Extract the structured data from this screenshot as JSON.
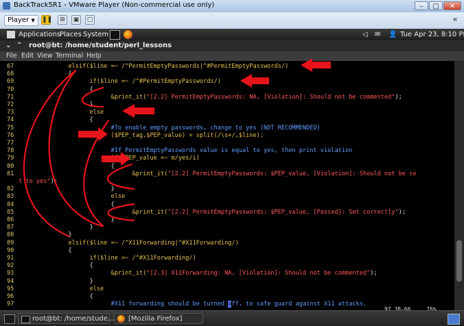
{
  "window": {
    "title": "BackTrack5R1 - VMware Player (Non-commercial use only)"
  },
  "vm_toolbar": {
    "player_label": "Player",
    "player_arrow": "▼"
  },
  "gnome_panel": {
    "applications": "Applications",
    "places": "Places",
    "system": "System",
    "datetime": "Tue Apr 23,  8:10 PM"
  },
  "terminal": {
    "title": "root@bt: /home/student/perl_lessons",
    "menu": [
      "File",
      "Edit",
      "View",
      "Terminal",
      "Help"
    ]
  },
  "code_lines": [
    {
      "n": "67",
      "segs": [
        [
          "              ",
          "w"
        ],
        [
          "elsif($line =~ /^PermitEmptyPasswords|^#PermitEmptyPasswords/)",
          "y"
        ]
      ]
    },
    {
      "n": "68",
      "segs": [
        [
          "              {",
          "w"
        ]
      ]
    },
    {
      "n": "69",
      "segs": [
        [
          "                    ",
          "w"
        ],
        [
          "if($line =~ /^#PermitEmptyPasswords/)",
          "y"
        ]
      ]
    },
    {
      "n": "70",
      "segs": [
        [
          "                    {",
          "w"
        ]
      ]
    },
    {
      "n": "71",
      "segs": [
        [
          "                          ",
          "w"
        ],
        [
          "&print_it(",
          "y"
        ],
        [
          "\"[2.2] PermitEmptyPasswords: NA, [Violation]: Should not be commented\"",
          "r"
        ],
        [
          ");",
          "w"
        ]
      ]
    },
    {
      "n": "72",
      "segs": [
        [
          "                    }",
          "w"
        ]
      ]
    },
    {
      "n": "73",
      "segs": [
        [
          "                    ",
          "w"
        ],
        [
          "else",
          "y"
        ]
      ]
    },
    {
      "n": "74",
      "segs": [
        [
          "                    {",
          "w"
        ]
      ]
    },
    {
      "n": "75",
      "segs": [
        [
          "                          ",
          "w"
        ],
        [
          "#To enable empty passwords, change to yes (NOT RECOMMENDED)",
          "c"
        ]
      ]
    },
    {
      "n": "76",
      "segs": [
        [
          "                          ",
          "w"
        ],
        [
          "($PEP_tag,$PEP_value) = split(/\\s+/,$line);",
          "y"
        ]
      ]
    },
    {
      "n": "77",
      "segs": []
    },
    {
      "n": "78",
      "segs": [
        [
          "                          ",
          "w"
        ],
        [
          "#If PermitEmptyPasswords value is equal to yes, then print violation",
          "c"
        ]
      ]
    },
    {
      "n": "79",
      "segs": [
        [
          "                          ",
          "w"
        ],
        [
          "if($PEP_value =~ m/yes/i)",
          "y"
        ]
      ]
    },
    {
      "n": "80",
      "segs": [
        [
          "                          {",
          "w"
        ]
      ]
    },
    {
      "n": "81",
      "segs": [
        [
          "                                ",
          "w"
        ],
        [
          "&print_it(",
          "y"
        ],
        [
          "\"[2.2] PermitEmptyPasswords: $PEP_value, [Violation]: Should not be se",
          "r"
        ]
      ]
    },
    {
      "n": "",
      "segs": [
        [
          "t to yes\"",
          "r"
        ],
        [
          ");",
          "w"
        ]
      ]
    },
    {
      "n": "82",
      "segs": [
        [
          "                          }",
          "w"
        ]
      ]
    },
    {
      "n": "83",
      "segs": [
        [
          "                          ",
          "w"
        ],
        [
          "else",
          "y"
        ]
      ]
    },
    {
      "n": "84",
      "segs": [
        [
          "                          {",
          "w"
        ]
      ]
    },
    {
      "n": "85",
      "segs": [
        [
          "                                ",
          "w"
        ],
        [
          "&print_it(",
          "y"
        ],
        [
          "\"[2.2] PermitEmptyPasswords: $PEP_value, [Passed]: Set correctly\"",
          "r"
        ],
        [
          ");",
          "w"
        ]
      ]
    },
    {
      "n": "86",
      "segs": [
        [
          "                          }",
          "w"
        ]
      ]
    },
    {
      "n": "87",
      "segs": [
        [
          "                    }",
          "w"
        ]
      ]
    },
    {
      "n": "88",
      "segs": [
        [
          "              }",
          "w"
        ]
      ]
    },
    {
      "n": "89",
      "segs": [
        [
          "              ",
          "w"
        ],
        [
          "elsif($line =~ /^X11Forwarding|^#X11Forwarding/)",
          "y"
        ]
      ]
    },
    {
      "n": "90",
      "segs": [
        [
          "              {",
          "w"
        ]
      ]
    },
    {
      "n": "91",
      "segs": [
        [
          "                    ",
          "w"
        ],
        [
          "if($line =~ /^#X11Forwarding/)",
          "y"
        ]
      ]
    },
    {
      "n": "92",
      "segs": [
        [
          "                    {",
          "w"
        ]
      ]
    },
    {
      "n": "93",
      "segs": [
        [
          "                          ",
          "w"
        ],
        [
          "&print_it(",
          "y"
        ],
        [
          "\"[2.3] X11Forwarding: NA, [Violation]: Should not be commented\"",
          "r"
        ],
        [
          ");",
          "w"
        ]
      ]
    },
    {
      "n": "94",
      "segs": [
        [
          "                    }",
          "w"
        ]
      ]
    },
    {
      "n": "95",
      "segs": [
        [
          "                    ",
          "w"
        ],
        [
          "else",
          "y"
        ]
      ]
    },
    {
      "n": "96",
      "segs": [
        [
          "                    {",
          "w"
        ]
      ]
    },
    {
      "n": "97",
      "segs": [
        [
          "                          ",
          "w"
        ],
        [
          "#X11 forwarding should be turned ",
          "c"
        ],
        [
          "o",
          "cursor"
        ],
        [
          "ff, to safe guard against X11 attacks.",
          "c"
        ]
      ]
    }
  ],
  "status_line": {
    "position": "97,38-66",
    "percent": "76%"
  },
  "taskbar": {
    "terminal_task": "root@bt: /home/stude...",
    "firefox_task": "[Mozilla Firefox]"
  },
  "colors": {
    "annotation_red": "#e8141b",
    "keyword_yellow": "#e8c14e",
    "string_red": "#ff5a5a",
    "comment_blue": "#5f9cff"
  }
}
